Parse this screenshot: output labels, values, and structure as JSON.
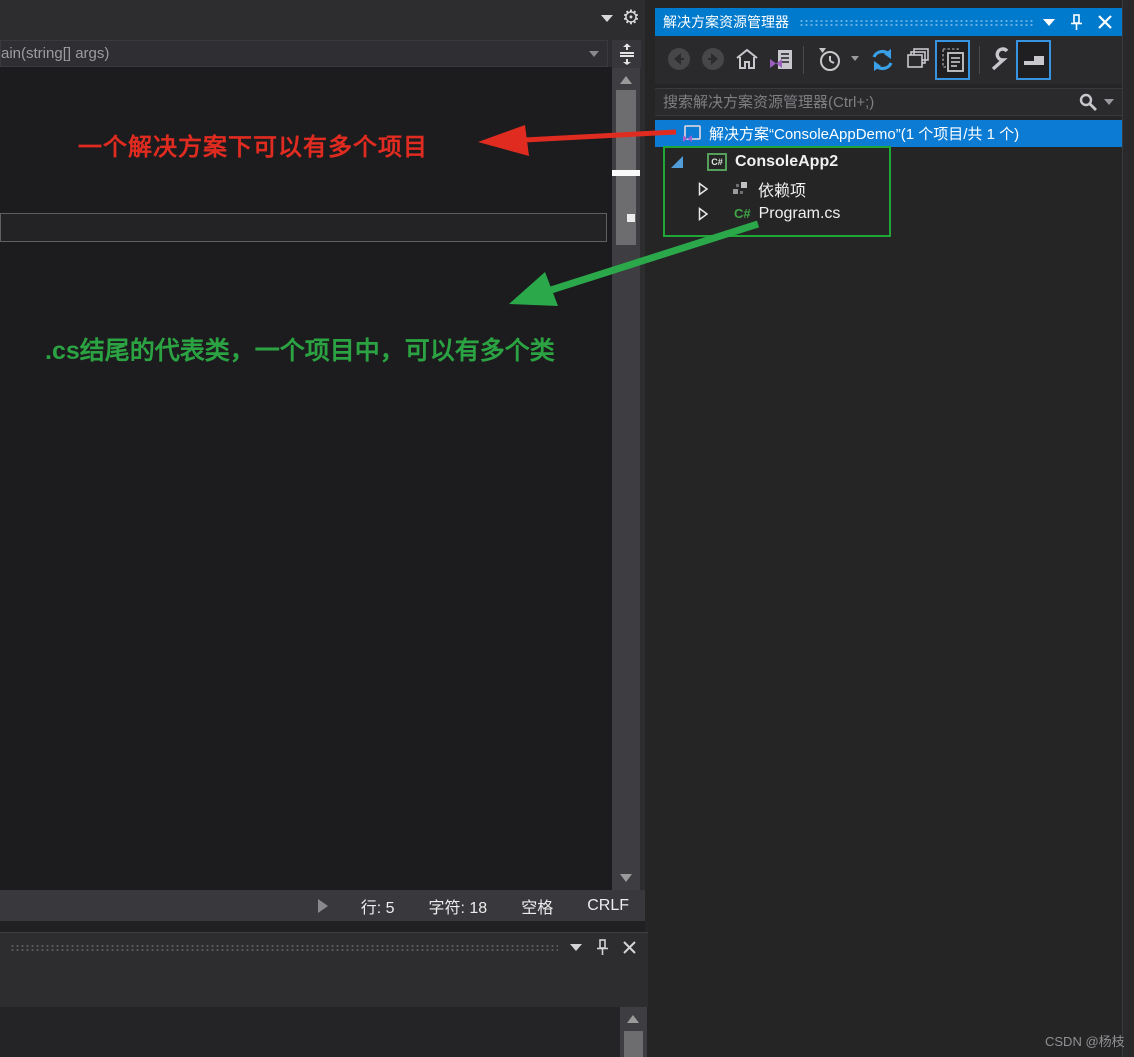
{
  "window": {
    "watermark": "CSDN @杨枝"
  },
  "editor": {
    "breadcrumb": "ain(string[] args)",
    "status_bar": {
      "line": "行: 5",
      "column": "字符: 18",
      "indent": "空格",
      "eol": "CRLF"
    }
  },
  "annotations": {
    "red_note": {
      "text": "一个解决方案下可以有多个项目",
      "color": "#e02b20"
    },
    "green_note": {
      "text": ".cs结尾的代表类，一个项目中，可以有多个类",
      "color": "#2ba342"
    }
  },
  "solution_explorer": {
    "title": "解决方案资源管理器",
    "search": {
      "placeholder": "搜索解决方案资源管理器(Ctrl+;)"
    },
    "toolbar_icons": [
      "back-icon",
      "forward-icon",
      "home-icon",
      "switch-views-icon",
      "pending-changes-filter-icon",
      "refresh-icon",
      "collapse-all-icon",
      "show-all-files-icon",
      "properties-wrench-icon",
      "preview-selected-items-icon"
    ],
    "tree": {
      "solution": "解决方案“ConsoleAppDemo”(1 个项目/共 1 个)",
      "project": "ConsoleApp2",
      "dependencies": "依赖项",
      "program": "Program.cs"
    },
    "colors": {
      "titlebar_active": "#007acc",
      "selected_row": "#0b7bd4",
      "toggle_border": "#3894e0",
      "refresh_blue": "#3aa0e8",
      "vs_purple": "#9b5fc0",
      "highlight_box": "#1fa637"
    }
  }
}
